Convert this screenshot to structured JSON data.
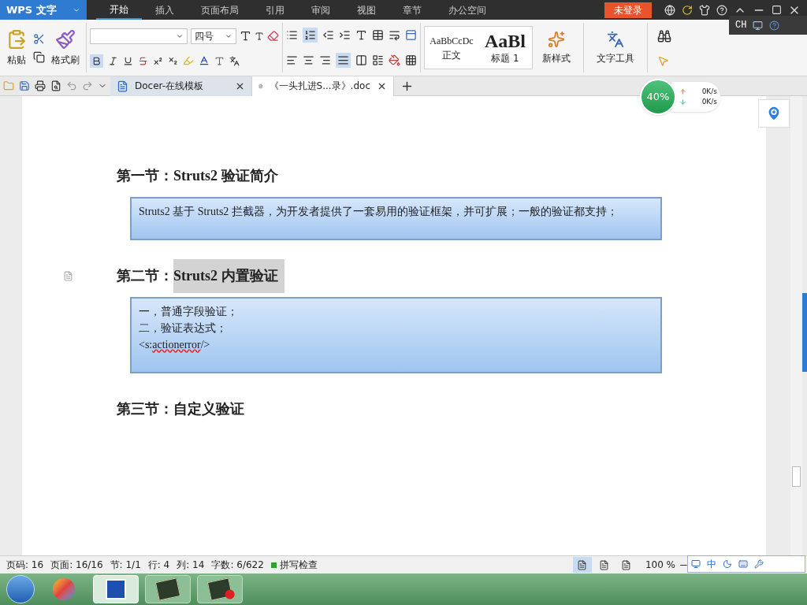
{
  "app_menu": {
    "label": "WPS 文字"
  },
  "menu_tabs": [
    {
      "label": "开始",
      "selected": true
    },
    {
      "label": "插入",
      "selected": false
    },
    {
      "label": "页面布局",
      "selected": false
    },
    {
      "label": "引用",
      "selected": false
    },
    {
      "label": "审阅",
      "selected": false
    },
    {
      "label": "视图",
      "selected": false
    },
    {
      "label": "章节",
      "selected": false
    },
    {
      "label": "办公空间",
      "selected": false
    }
  ],
  "login_button": "未登录",
  "ime_bar": {
    "label": "CH"
  },
  "ribbon": {
    "paste": "粘贴",
    "format_painter": "格式刷",
    "font_size": "四号",
    "styles": [
      {
        "preview": "AaBbCcDc",
        "label": "正文",
        "kind": "body"
      },
      {
        "preview": "AaBl",
        "label": "标题 1",
        "kind": "heading"
      }
    ],
    "new_style": "新样式",
    "text_tools": "文字工具"
  },
  "doc_tabs": [
    {
      "label": "Docer-在线模板",
      "selected": false,
      "kind": "docer"
    },
    {
      "label": "《一头扎进S...录》.doc",
      "selected": true,
      "kind": "doc"
    }
  ],
  "speed_widget": {
    "percent": "40%",
    "upload": "0K/s",
    "download": "0K/s"
  },
  "document": [
    {
      "kind": "heading",
      "marker": false,
      "parts": [
        {
          "text": "第一节：Struts2 验证简介",
          "selected": false
        }
      ]
    },
    {
      "kind": "box",
      "lines": [
        [
          {
            "text": "Struts2 基于 Struts2 拦截器，为开发者提供了一套易用的验证框架，并可扩展；一般的验证都支持；",
            "misspelled": false
          }
        ]
      ]
    },
    {
      "kind": "heading",
      "marker": true,
      "parts": [
        {
          "text": "第二节：",
          "selected": false
        },
        {
          "text": "Struts2 内置验证",
          "selected": true
        }
      ]
    },
    {
      "kind": "box",
      "lines": [
        [
          {
            "text": "一，普通字段验证；",
            "misspelled": false
          }
        ],
        [
          {
            "text": "二，验证表达式；",
            "misspelled": false
          }
        ],
        [
          {
            "text": "<s:",
            "misspelled": false
          },
          {
            "text": "actionerror",
            "misspelled": true
          },
          {
            "text": "/>",
            "misspelled": false
          }
        ]
      ]
    },
    {
      "kind": "heading",
      "marker": false,
      "parts": [
        {
          "text": "第三节：自定义验证",
          "selected": false
        }
      ]
    }
  ],
  "status_bar": {
    "items": [
      "页码: 16",
      "页面: 16/16",
      "节: 1/1",
      "行: 4",
      "列: 14",
      "字数: 6/622"
    ],
    "spell_check": {
      "label": "拼写检查",
      "on": true
    },
    "view_modes": [
      {
        "selected": true
      },
      {
        "selected": false
      },
      {
        "selected": false
      }
    ],
    "zoom": "100 %",
    "ime": "中"
  },
  "taskbar": [
    {
      "kind": "squares",
      "selected": false
    },
    {
      "kind": "wps",
      "selected": true
    },
    {
      "kind": "app",
      "selected": false
    },
    {
      "kind": "app-record",
      "selected": false
    }
  ]
}
